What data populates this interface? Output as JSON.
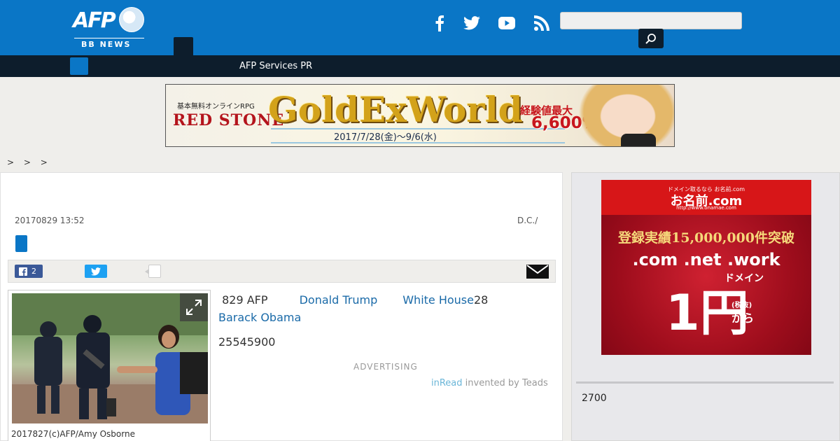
{
  "header": {
    "logo_text": "AFP",
    "logo_sub": "BB NEWS",
    "social": [
      "facebook-icon",
      "twitter-icon",
      "youtube-icon",
      "rss-icon"
    ],
    "search_placeholder": ""
  },
  "nav": {
    "link": "AFP Services PR"
  },
  "banner": {
    "rpg": "基本無料オンラインRPG",
    "brand": "RED STONE",
    "title": "GoldExWorld",
    "date": "2017/7/28(金)〜9/6(水)",
    "exp": "経験値最大",
    "exp_num": "6,600%!"
  },
  "breadcrumb": "> > >",
  "article": {
    "date": "20170829 13:52",
    "place": "D.C./",
    "share_fb_count": "2",
    "text_lead": "829 AFP ",
    "link_trump": "Donald Trump",
    "link_whitehouse": "White House",
    "text_28": "28",
    "link_obama": "Barack Obama",
    "number": "25545900",
    "advertising": "ADVERTISING",
    "inread_brand": "inRead",
    "inread_rest": " invented by Teads",
    "caption": "2017827(c)AFP/Amy Osborne"
  },
  "sidebar": {
    "ad": {
      "small": "ドメイン取るなら お名前.com",
      "brand": "お名前.com",
      "url": "http://www.onamae.com",
      "count": "登録実績15,000,000件突破",
      "domains": ".com .net .work",
      "domain_word": "ドメイン",
      "price": "1円",
      "tax": "(税抜)",
      "kara": "から"
    },
    "number": "2700"
  },
  "colors": {
    "header_blue": "#0a76c6",
    "nav_dark": "#0d1d2c",
    "link_blue": "#1a6aa8"
  }
}
